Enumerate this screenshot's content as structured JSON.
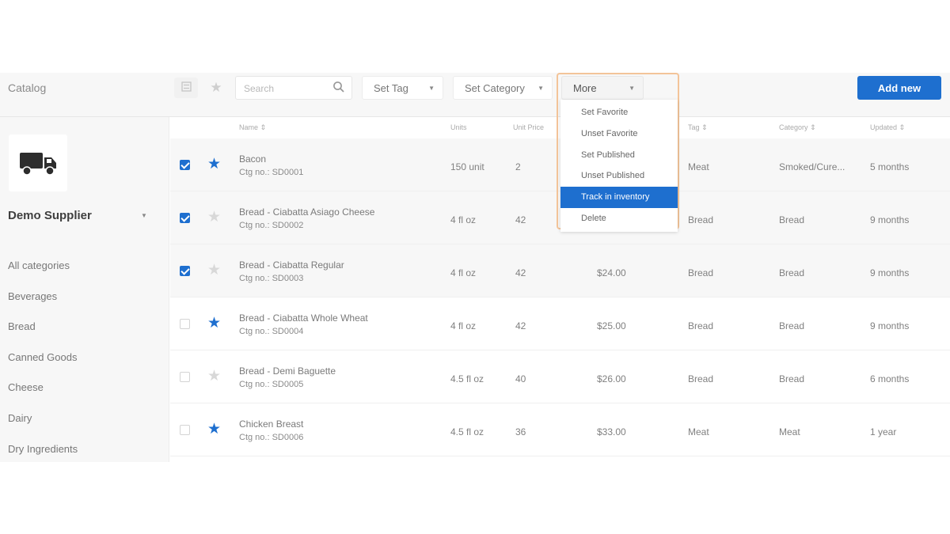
{
  "topbar": {
    "title": "Catalog",
    "search_placeholder": "Search",
    "set_tag": "Set Tag",
    "set_category": "Set Category",
    "more": "More",
    "add_new": "Add new"
  },
  "sidebar": {
    "supplier": "Demo Supplier",
    "categories": [
      "All categories",
      "Beverages",
      "Bread",
      "Canned Goods",
      "Cheese",
      "Dairy",
      "Dry Ingredients"
    ]
  },
  "table": {
    "headers": {
      "name": "Name ⇕",
      "units": "Units",
      "unit_price": "Unit Price",
      "tag": "Tag ⇕",
      "category": "Category ⇕",
      "updated": "Updated ⇕"
    },
    "rows": [
      {
        "name": "Bacon",
        "sku": "Ctg no.: SD0001",
        "units": "150 unit",
        "qty": "2",
        "price": "",
        "tag": "Meat",
        "category": "Smoked/Cure...",
        "updated": "5 months",
        "checked": true,
        "favorite": true
      },
      {
        "name": "Bread - Ciabatta Asiago Cheese",
        "sku": "Ctg no.: SD0002",
        "units": "4 fl oz",
        "qty": "42",
        "price": "",
        "tag": "Bread",
        "category": "Bread",
        "updated": "9 months",
        "checked": true,
        "favorite": false
      },
      {
        "name": "Bread - Ciabatta Regular",
        "sku": "Ctg no.: SD0003",
        "units": "4 fl oz",
        "qty": "42",
        "price": "$24.00",
        "tag": "Bread",
        "category": "Bread",
        "updated": "9 months",
        "checked": true,
        "favorite": false
      },
      {
        "name": "Bread - Ciabatta Whole Wheat",
        "sku": "Ctg no.: SD0004",
        "units": "4 fl oz",
        "qty": "42",
        "price": "$25.00",
        "tag": "Bread",
        "category": "Bread",
        "updated": "9 months",
        "checked": false,
        "favorite": true
      },
      {
        "name": "Bread - Demi Baguette",
        "sku": "Ctg no.: SD0005",
        "units": "4.5 fl oz",
        "qty": "40",
        "price": "$26.00",
        "tag": "Bread",
        "category": "Bread",
        "updated": "6 months",
        "checked": false,
        "favorite": false
      },
      {
        "name": "Chicken Breast",
        "sku": "Ctg no.: SD0006",
        "units": "4.5 fl oz",
        "qty": "36",
        "price": "$33.00",
        "tag": "Meat",
        "category": "Meat",
        "updated": "1 year",
        "checked": false,
        "favorite": true
      }
    ]
  },
  "more_menu": {
    "items": [
      "Set Favorite",
      "Unset Favorite",
      "Set Published",
      "Unset Published",
      "Track in inventory",
      "Delete"
    ],
    "active_index": 4
  },
  "colors": {
    "accent": "#1e6fcf",
    "menu_outline": "#f3c499",
    "sidebar_bg": "#f7f7f7"
  },
  "icons": {
    "list_view": "list-view-icon",
    "favorites_filter": "star-icon",
    "search": "search-icon",
    "supplier_logo": "truck-icon",
    "row_favorite": "star-icon"
  }
}
